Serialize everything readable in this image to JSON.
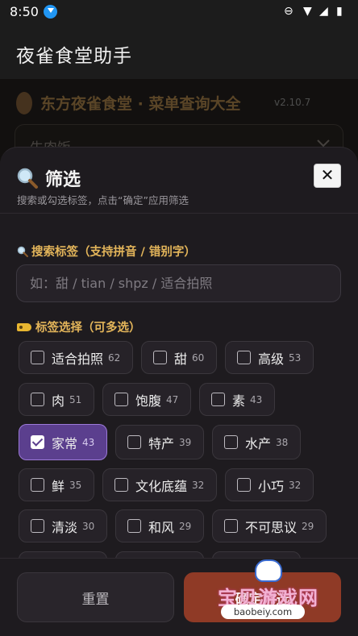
{
  "status_bar": {
    "time": "8:50"
  },
  "app_bar": {
    "title": "夜雀食堂助手"
  },
  "background_page": {
    "heading": "东方夜雀食堂 · 菜单查询大全",
    "version": "v2.10.7",
    "select_value": "牛肉饭"
  },
  "sheet": {
    "title": "筛选",
    "subtitle": "搜索或勾选标签，点击“确定”应用筛选",
    "search_section_label": "搜索标签（支持拼音 / 错别字）",
    "search_placeholder": "如：甜 / tian / shpz / 适合拍照",
    "tags_section_label": "标签选择（可多选）",
    "tags": [
      {
        "name": "适合拍照",
        "count": "62",
        "selected": false
      },
      {
        "name": "甜",
        "count": "60",
        "selected": false
      },
      {
        "name": "高级",
        "count": "53",
        "selected": false
      },
      {
        "name": "肉",
        "count": "51",
        "selected": false
      },
      {
        "name": "饱腹",
        "count": "47",
        "selected": false
      },
      {
        "name": "素",
        "count": "43",
        "selected": false
      },
      {
        "name": "家常",
        "count": "43",
        "selected": true
      },
      {
        "name": "特产",
        "count": "39",
        "selected": false
      },
      {
        "name": "水产",
        "count": "38",
        "selected": false
      },
      {
        "name": "鲜",
        "count": "35",
        "selected": false
      },
      {
        "name": "文化底蕴",
        "count": "32",
        "selected": false
      },
      {
        "name": "小巧",
        "count": "32",
        "selected": false
      },
      {
        "name": "清淡",
        "count": "30",
        "selected": false
      },
      {
        "name": "和风",
        "count": "29",
        "selected": false
      },
      {
        "name": "不可思议",
        "count": "29",
        "selected": false
      }
    ],
    "reset_label": "重置",
    "confirm_label": "确定筛选"
  },
  "watermark": {
    "text": "宝贝游戏网",
    "url": "baobeiy.com"
  },
  "colors": {
    "accent": "#e3b55a",
    "selected_chip": "#5b3f8e",
    "confirm": "#8f3a26"
  }
}
